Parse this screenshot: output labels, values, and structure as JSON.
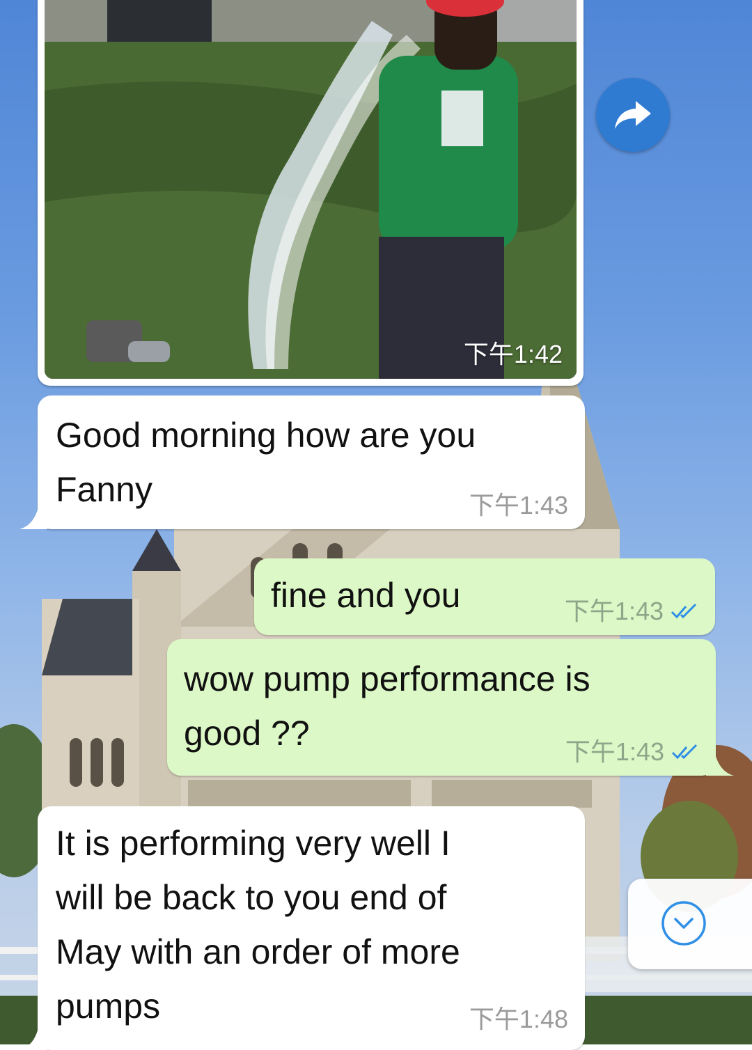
{
  "messages": [
    {
      "direction": "incoming",
      "type": "photo",
      "time": "下午1:42"
    },
    {
      "direction": "incoming",
      "type": "text",
      "lines": [
        "Good morning how are you",
        "Fanny"
      ],
      "time": "下午1:43"
    },
    {
      "direction": "outgoing",
      "type": "text",
      "lines": [
        "fine and you"
      ],
      "time": "下午1:43",
      "status": "read"
    },
    {
      "direction": "outgoing",
      "type": "text",
      "lines": [
        "wow pump performance is",
        "good ??"
      ],
      "time": "下午1:43",
      "status": "read"
    },
    {
      "direction": "incoming",
      "type": "text",
      "lines": [
        "It is performing very well I",
        "will be back to you end of",
        "May with an order of more",
        "pumps"
      ],
      "time": "下午1:48"
    }
  ],
  "buttons": {
    "forward": {
      "icon": "forward-arrow-icon"
    },
    "scroll_down": {
      "icon": "chevron-down-circle-icon"
    }
  },
  "colors": {
    "incoming_bubble": "#ffffff",
    "outgoing_bubble": "#dcf8c6",
    "read_tick": "#2f8fe6",
    "forward_button": "#2f7bd2"
  }
}
